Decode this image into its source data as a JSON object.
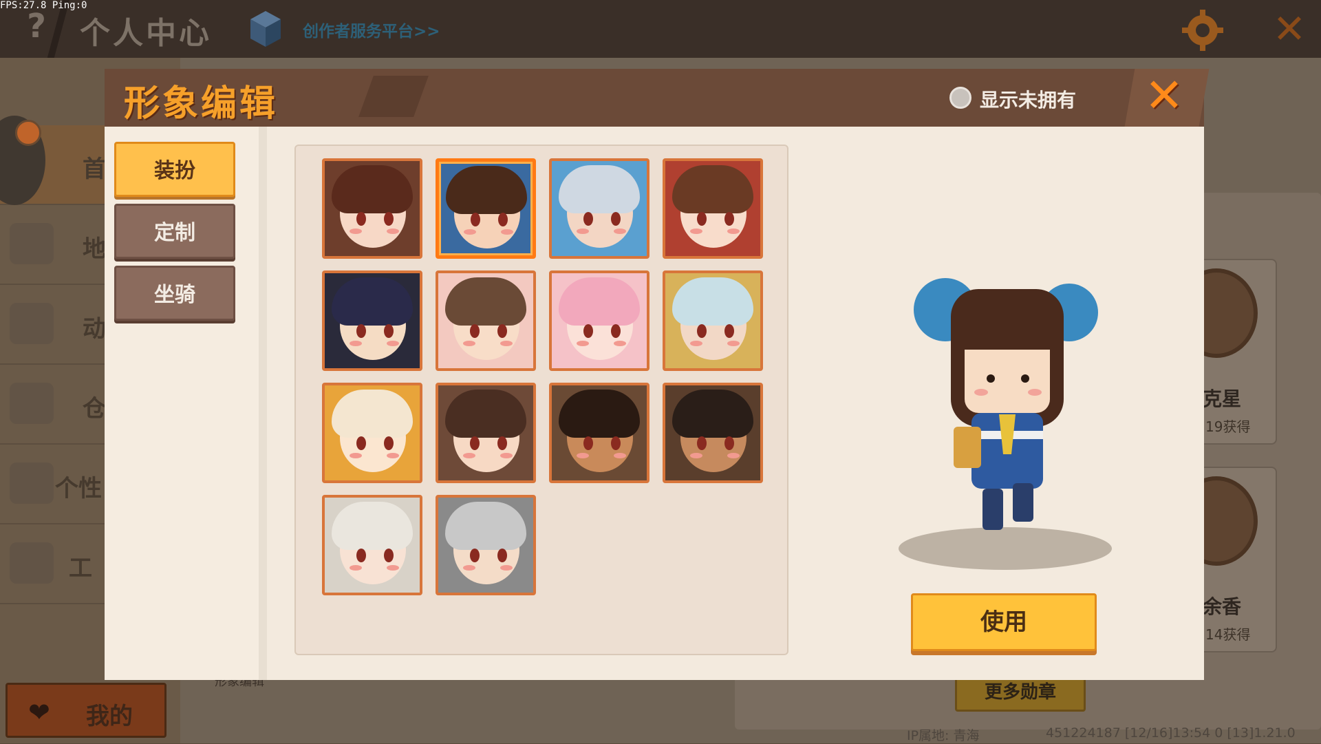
{
  "debug": {
    "fps_text": "FPS:27.8  Ping:0"
  },
  "topbar": {
    "help_icon": "question-icon",
    "title": "个人中心",
    "creator_link": "创作者服务平台>>",
    "settings_icon": "gear-icon",
    "close_icon": "close-icon"
  },
  "sidebar": {
    "items": [
      {
        "label": "首",
        "icon": "home-icon"
      },
      {
        "label": "地",
        "icon": "map-icon"
      },
      {
        "label": "动",
        "icon": "bell-icon"
      },
      {
        "label": "仓",
        "icon": "box-icon"
      },
      {
        "label": "个性",
        "icon": "card-icon"
      },
      {
        "label": "工",
        "icon": "toolbox-icon"
      }
    ],
    "mine_label": "我的",
    "mine_icon": "heart-icon"
  },
  "background": {
    "under_caption": "形象编辑",
    "badges": [
      {
        "name": "克星",
        "sub": "19获得"
      },
      {
        "name": "余香",
        "sub": "14获得"
      }
    ],
    "more_badges": "更多勋章",
    "ip_text": "IP属地: 青海",
    "version_text": "451224187   [12/16]13:54 0   [13]1.21.0"
  },
  "modal": {
    "title": "形象编辑",
    "show_unowned_label": "显示未拥有",
    "show_unowned_checked": false,
    "close_icon": "close-x-icon",
    "tabs": [
      {
        "label": "装扮",
        "active": true
      },
      {
        "label": "定制",
        "active": false
      },
      {
        "label": "坐骑",
        "active": false
      }
    ],
    "avatars": [
      {
        "hair": "#5a2a1c",
        "face": "#f7d8c6",
        "bg": "#6e3e2c",
        "selected": false
      },
      {
        "hair": "#4a2a1a",
        "face": "#f6d2b8",
        "bg": "#3a6aa0",
        "selected": true
      },
      {
        "hair": "#cfd8e2",
        "face": "#f3d6c4",
        "bg": "#5aa0d0",
        "selected": false
      },
      {
        "hair": "#6a3a24",
        "face": "#f8dccb",
        "bg": "#b04030",
        "selected": false
      },
      {
        "hair": "#2a2a4a",
        "face": "#f5dcc4",
        "bg": "#2a2a3a",
        "selected": false
      },
      {
        "hair": "#6a4a36",
        "face": "#f8ddc8",
        "bg": "#f3c9c0",
        "selected": false
      },
      {
        "hair": "#f2a8bc",
        "face": "#fbe1d8",
        "bg": "#f5c2c8",
        "selected": false
      },
      {
        "hair": "#c8dfe6",
        "face": "#f2d8c6",
        "bg": "#d8b25a",
        "selected": false
      },
      {
        "hair": "#f4e6d0",
        "face": "#fbe6d0",
        "bg": "#e8a43a",
        "selected": false
      },
      {
        "hair": "#4a2e22",
        "face": "#f7d9c4",
        "bg": "#6e4a38",
        "selected": false
      },
      {
        "hair": "#2a1a12",
        "face": "#c98a5a",
        "bg": "#6a4a34",
        "selected": false
      },
      {
        "hair": "#2a1e18",
        "face": "#c68a5e",
        "bg": "#5a3e2c",
        "selected": false
      },
      {
        "hair": "#eae6de",
        "face": "#f8e2d4",
        "bg": "#d8d2c8",
        "selected": false
      },
      {
        "hair": "#c8c8c8",
        "face": "#f4dcc8",
        "bg": "#8a8a8a",
        "selected": false
      }
    ],
    "use_button": "使用"
  }
}
